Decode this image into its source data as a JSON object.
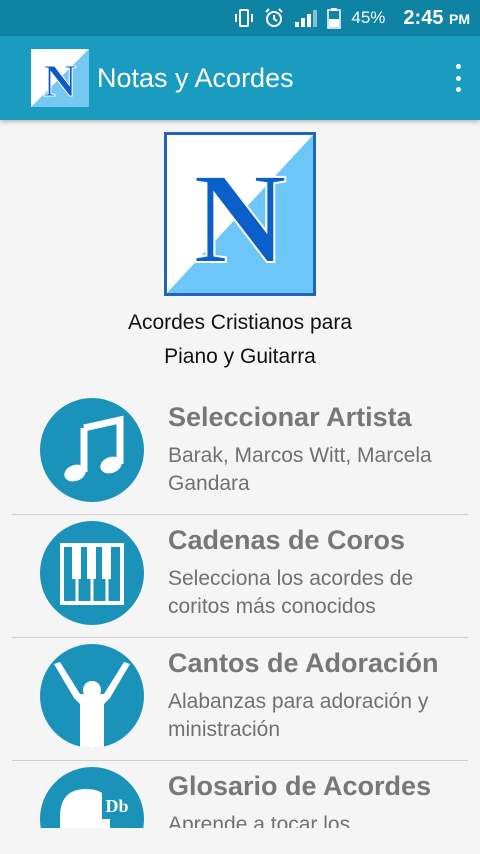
{
  "status_bar": {
    "battery": "45%",
    "time": "2:45",
    "ampm": "PM",
    "icons": [
      "vibrate-icon",
      "alarm-icon",
      "signal-icon",
      "battery-icon"
    ]
  },
  "app_bar": {
    "title": "Notas y Acordes",
    "logo_letter": "N",
    "menu_icon": "overflow-menu-icon",
    "color": "#1a9bc0"
  },
  "hero": {
    "logo_letter": "N",
    "tagline_line1": "Acordes Cristianos para",
    "tagline_line2": "Piano y Guitarra"
  },
  "menu": {
    "items": [
      {
        "title": "Seleccionar Artista",
        "subtitle": "Barak, Marcos Witt, Marcela Gandara",
        "icon": "music-note-icon"
      },
      {
        "title": "Cadenas de Coros",
        "subtitle": "Selecciona los acordes de coritos más conocidos",
        "icon": "piano-keys-icon"
      },
      {
        "title": "Cantos de Adoración",
        "subtitle": "Alabanzas para adoración y ministración",
        "icon": "worship-person-icon"
      },
      {
        "title": "Glosario de Acordes",
        "subtitle": "Aprende a tocar los",
        "icon": "chord-db-icon",
        "icon_label": "Db"
      }
    ]
  },
  "colors": {
    "status_bar": "#0e83a3",
    "accent": "#1a92ba",
    "title_gray": "#777777"
  }
}
